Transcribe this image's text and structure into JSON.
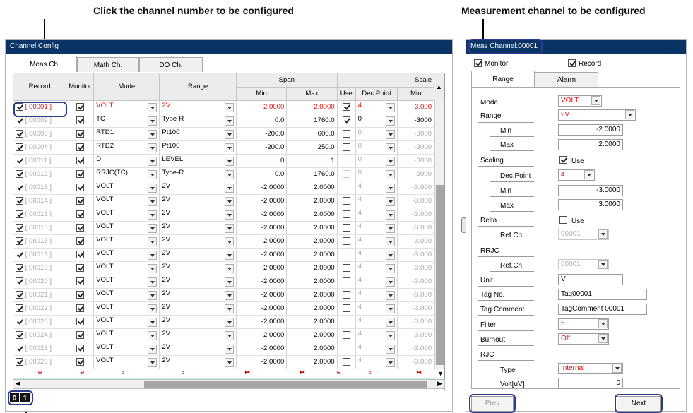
{
  "captions": {
    "left": "Click the channel number to be configured",
    "right": "Measurement channel to be configured"
  },
  "left_panel": {
    "title": "Channel Config",
    "tabs": [
      {
        "label": "Meas Ch."
      },
      {
        "label": "Math Ch."
      },
      {
        "label": "DO Ch."
      }
    ],
    "columns": {
      "record": "Record",
      "monitor": "Monitor",
      "mode": "Mode",
      "range": "Range",
      "span": "Span",
      "scale": "Scale",
      "min": "Min",
      "max": "Max",
      "use": "Use",
      "dec_point": "Dec.Point",
      "scale_min": "Min"
    },
    "rows": [
      {
        "record": "[ 00001 ]",
        "mode": "VOLT",
        "range": "2V",
        "min": "-2.0000",
        "max": "2.0000",
        "use": true,
        "dec": "4",
        "smin": "-3.000"
      },
      {
        "record": "[ 00002 ]",
        "mode": "TC",
        "range": "Type-R",
        "min": "0.0",
        "max": "1760.0",
        "use": true,
        "dec": "0",
        "smin": "-3000"
      },
      {
        "record": "[ 00003 ]",
        "mode": "RTD1",
        "range": "Pt100",
        "min": "-200.0",
        "max": "600.0",
        "use": false,
        "dec": "0",
        "smin": "-3000"
      },
      {
        "record": "[ 00004 ]",
        "mode": "RTD2",
        "range": "Pt100",
        "min": "-200.0",
        "max": "250.0",
        "use": false,
        "dec": "0",
        "smin": "-3000"
      },
      {
        "record": "[ 00011 ]",
        "mode": "DI",
        "range": "LEVEL",
        "min": "0",
        "max": "1",
        "use": false,
        "dec": "0",
        "smin": "-3000"
      },
      {
        "record": "[ 00012 ]",
        "mode": "RRJC(TC)",
        "range": "Type-R",
        "min": "0.0",
        "max": "1760.0",
        "use": false,
        "dec": "0",
        "smin": "-3000"
      },
      {
        "record": "[ 00013 ]",
        "mode": "VOLT",
        "range": "2V",
        "min": "-2.0000",
        "max": "2.0000",
        "use": false,
        "dec": "4",
        "smin": "-3.000"
      },
      {
        "record": "[ 00014 ]",
        "mode": "VOLT",
        "range": "2V",
        "min": "-2.0000",
        "max": "2.0000",
        "use": false,
        "dec": "4",
        "smin": "-3.000"
      },
      {
        "record": "[ 00015 ]",
        "mode": "VOLT",
        "range": "2V",
        "min": "-2.0000",
        "max": "2.0000",
        "use": false,
        "dec": "4",
        "smin": "-3.000"
      },
      {
        "record": "[ 00016 ]",
        "mode": "VOLT",
        "range": "2V",
        "min": "-2.0000",
        "max": "2.0000",
        "use": false,
        "dec": "4",
        "smin": "-3.000"
      },
      {
        "record": "[ 00017 ]",
        "mode": "VOLT",
        "range": "2V",
        "min": "-2.0000",
        "max": "2.0000",
        "use": false,
        "dec": "4",
        "smin": "-3.000"
      },
      {
        "record": "[ 00018 ]",
        "mode": "VOLT",
        "range": "2V",
        "min": "-2.0000",
        "max": "2.0000",
        "use": false,
        "dec": "4",
        "smin": "-3.000"
      },
      {
        "record": "[ 00019 ]",
        "mode": "VOLT",
        "range": "2V",
        "min": "-2.0000",
        "max": "2.0000",
        "use": false,
        "dec": "4",
        "smin": "-3.000"
      },
      {
        "record": "[ 00020 ]",
        "mode": "VOLT",
        "range": "2V",
        "min": "-2.0000",
        "max": "2.0000",
        "use": false,
        "dec": "4",
        "smin": "-3.000"
      },
      {
        "record": "[ 00021 ]",
        "mode": "VOLT",
        "range": "2V",
        "min": "-2.0000",
        "max": "2.0000",
        "use": false,
        "dec": "4",
        "smin": "-3.000"
      },
      {
        "record": "[ 00022 ]",
        "mode": "VOLT",
        "range": "2V",
        "min": "-2.0000",
        "max": "2.0000",
        "use": false,
        "dec": "4",
        "smin": "-3.000"
      },
      {
        "record": "[ 00023 ]",
        "mode": "VOLT",
        "range": "2V",
        "min": "-2.0000",
        "max": "2.0000",
        "use": false,
        "dec": "4",
        "smin": "-3.000"
      },
      {
        "record": "[ 00024 ]",
        "mode": "VOLT",
        "range": "2V",
        "min": "-2.0000",
        "max": "2.0000",
        "use": false,
        "dec": "4",
        "smin": "-3.000"
      },
      {
        "record": "[ 00025 ]",
        "mode": "VOLT",
        "range": "2V",
        "min": "-2.0000",
        "max": "2.0000",
        "use": false,
        "dec": "4",
        "smin": "-3.000"
      },
      {
        "record": "[ 00026 ]",
        "mode": "VOLT",
        "range": "2V",
        "min": "-2.0000",
        "max": "2.0000",
        "use": false,
        "dec": "4",
        "smin": "-3.000"
      }
    ],
    "page_indicator": [
      "0",
      "1"
    ]
  },
  "right_panel": {
    "title": "Meas Channel:00001",
    "monitor_label": "Monitor",
    "record_label": "Record",
    "tabs": [
      {
        "label": "Range"
      },
      {
        "label": "Alarm"
      }
    ],
    "fields": {
      "mode_label": "Mode",
      "mode_value": "VOLT",
      "range_label": "Range",
      "range_value": "2V",
      "min_label": "Min",
      "min_value": "-2.0000",
      "max_label": "Max",
      "max_value": "2.0000",
      "scaling_label": "Scaling",
      "use_label": "Use",
      "dec_label": "Dec.Point",
      "dec_value": "4",
      "smin_label": "Min",
      "smin_value": "-3.0000",
      "smax_label": "Max",
      "smax_value": "3.0000",
      "delta_label": "Delta",
      "delta_use_label": "Use",
      "refch_label": "Ref.Ch.",
      "refch_value": "00001",
      "rrjc_label": "RRJC",
      "rrjc_refch_label": "Ref.Ch.",
      "rrjc_refch_value": "00001",
      "unit_label": "Unit",
      "unit_value": "V",
      "tagno_label": "Tag No.",
      "tagno_value": "Tag00001",
      "tagcomment_label": "Tag Comment",
      "tagcomment_value": "TagComment 00001",
      "filter_label": "Filter",
      "filter_value": "5",
      "burnout_label": "Burnout",
      "burnout_value": "Off",
      "rjc_label": "RJC",
      "type_label": "Type",
      "type_value": "Internal",
      "volt_label": "Volt[uV]",
      "volt_value": "0"
    },
    "prev_label": "Prev",
    "next_label": "Next"
  },
  "colors": {
    "title_bar": "#0b3466",
    "highlight": "#2b3a8c",
    "selected_text": "#e01010"
  }
}
